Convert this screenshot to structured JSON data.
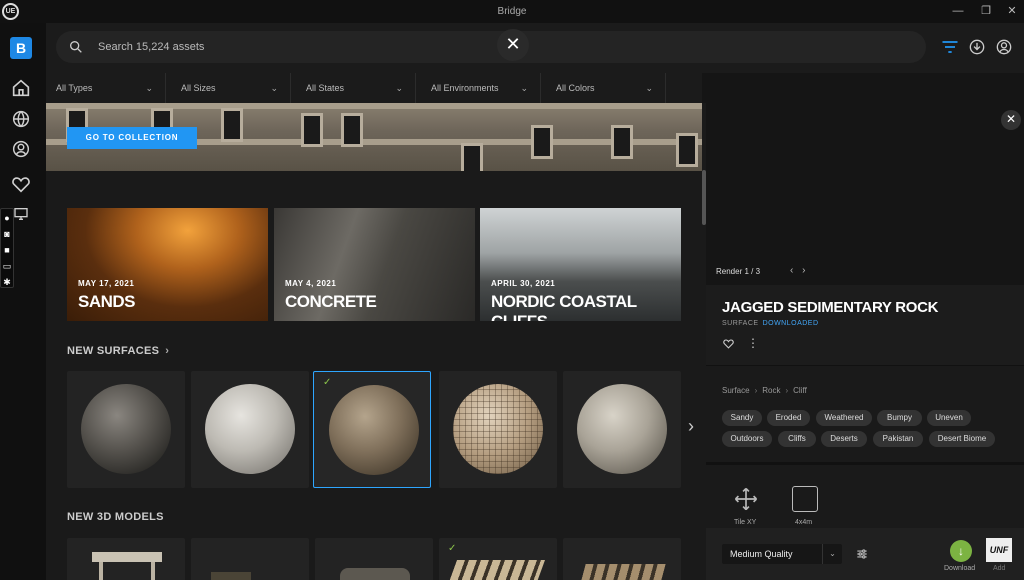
{
  "window": {
    "title": "Bridge",
    "logo": "UE",
    "controls": [
      "—",
      "❐",
      "✕"
    ]
  },
  "sidebar": {
    "logo": "B",
    "items": [
      "home-icon",
      "globe-icon",
      "user-icon",
      "heart-icon",
      "monitor-icon"
    ]
  },
  "search": {
    "placeholder": "Search 15,224 assets",
    "clear": "✕"
  },
  "filters": [
    "All Types",
    "All Sizes",
    "All States",
    "All Environments",
    "All Colors"
  ],
  "hero": {
    "cta": "GO TO COLLECTION"
  },
  "collections": [
    {
      "date": "MAY 17, 2021",
      "name": "SANDS"
    },
    {
      "date": "MAY 4, 2021",
      "name": "CONCRETE"
    },
    {
      "date": "APRIL 30, 2021",
      "name": "NORDIC COASTAL CLIFFS"
    }
  ],
  "sections": {
    "surfaces": "NEW SURFACES",
    "models": "NEW 3D MODELS",
    "chevron": "›"
  },
  "surface_check": "✓",
  "next_arrow": "›",
  "detail": {
    "render": "Render 1 / 3",
    "render_nav": "‹ ›",
    "title": "JAGGED SEDIMENTARY ROCK",
    "type": "SURFACE",
    "status": "DOWNLOADED",
    "more": "⋮",
    "breadcrumbs": [
      "Surface",
      "Rock",
      "Cliff"
    ],
    "breadcrumb_sep": "›",
    "tags": [
      "Sandy",
      "Eroded",
      "Weathered",
      "Bumpy",
      "Uneven",
      "Outdoors",
      "Cliffs",
      "Deserts",
      "Pakistan",
      "Desert Biome"
    ],
    "tools": [
      {
        "label": "Tile XY"
      },
      {
        "label": "4x4m"
      }
    ],
    "quality": "Medium Quality",
    "quality_dropdown": "⌄",
    "download_icon": "↓",
    "download_label": "Download",
    "add_logo": "UNF",
    "add_label": "Add"
  },
  "colors": {
    "accent": "#2196f3",
    "download": "#7cb342",
    "selection": "#2ea6ff"
  }
}
